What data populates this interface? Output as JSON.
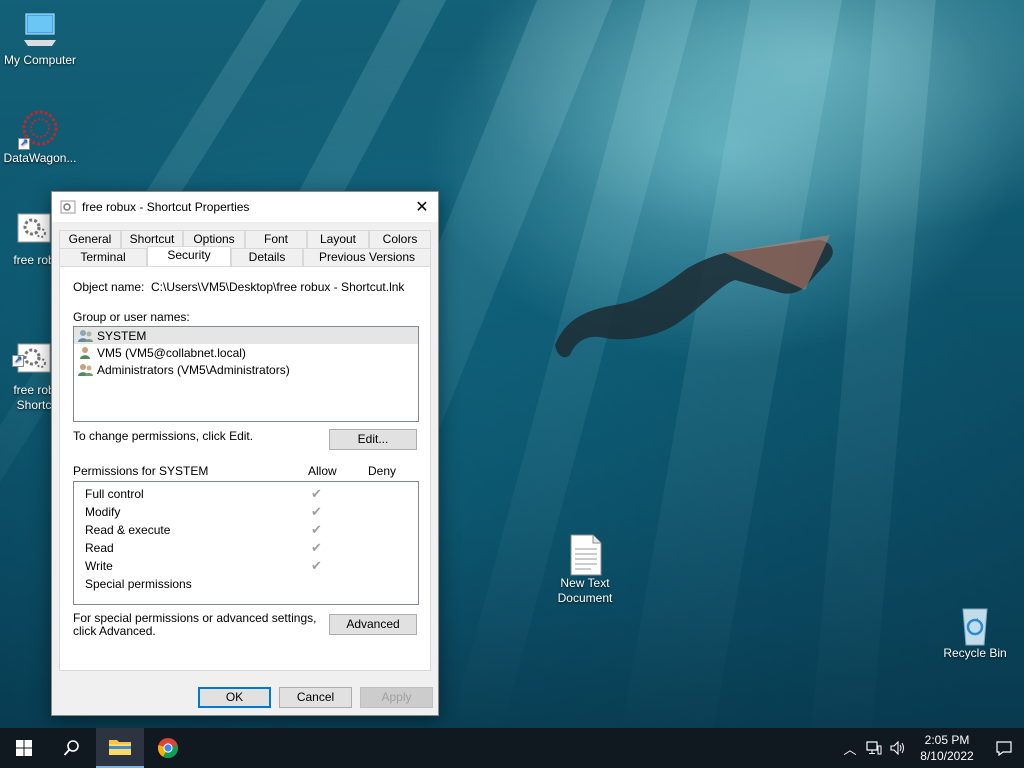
{
  "desktop": {
    "icons": [
      {
        "label": "My Computer"
      },
      {
        "label": "DataWagon..."
      },
      {
        "label": "free rob"
      },
      {
        "label": "free rob\nShortc"
      },
      {
        "label": "New Text\nDocument"
      },
      {
        "label": "Recycle Bin"
      }
    ]
  },
  "dialog": {
    "title": "free robux - Shortcut Properties",
    "tabs_back": [
      "General",
      "Shortcut",
      "Options",
      "Font",
      "Layout",
      "Colors"
    ],
    "tabs_front": [
      "Terminal",
      "Security",
      "Details",
      "Previous Versions"
    ],
    "active_tab": "Security",
    "object_name_label": "Object name:",
    "object_name_value": "C:\\Users\\VM5\\Desktop\\free robux - Shortcut.lnk",
    "group_label": "Group or user names:",
    "users": [
      {
        "name": "SYSTEM",
        "selected": true
      },
      {
        "name": "VM5 (VM5@collabnet.local)",
        "selected": false
      },
      {
        "name": "Administrators (VM5\\Administrators)",
        "selected": false
      }
    ],
    "change_text": "To change permissions, click Edit.",
    "edit_button": "Edit...",
    "permissions_for": "Permissions for SYSTEM",
    "allow_label": "Allow",
    "deny_label": "Deny",
    "permissions": [
      {
        "name": "Full control",
        "allow": true
      },
      {
        "name": "Modify",
        "allow": true
      },
      {
        "name": "Read & execute",
        "allow": true
      },
      {
        "name": "Read",
        "allow": true
      },
      {
        "name": "Write",
        "allow": true
      },
      {
        "name": "Special permissions",
        "allow": false
      }
    ],
    "advanced_text": "For special permissions or advanced settings, click Advanced.",
    "advanced_button": "Advanced",
    "ok_button": "OK",
    "cancel_button": "Cancel",
    "apply_button": "Apply"
  },
  "taskbar": {
    "time": "2:05 PM",
    "date": "8/10/2022"
  },
  "colors": {
    "accent": "#0078d7",
    "taskbar": "#101820"
  }
}
